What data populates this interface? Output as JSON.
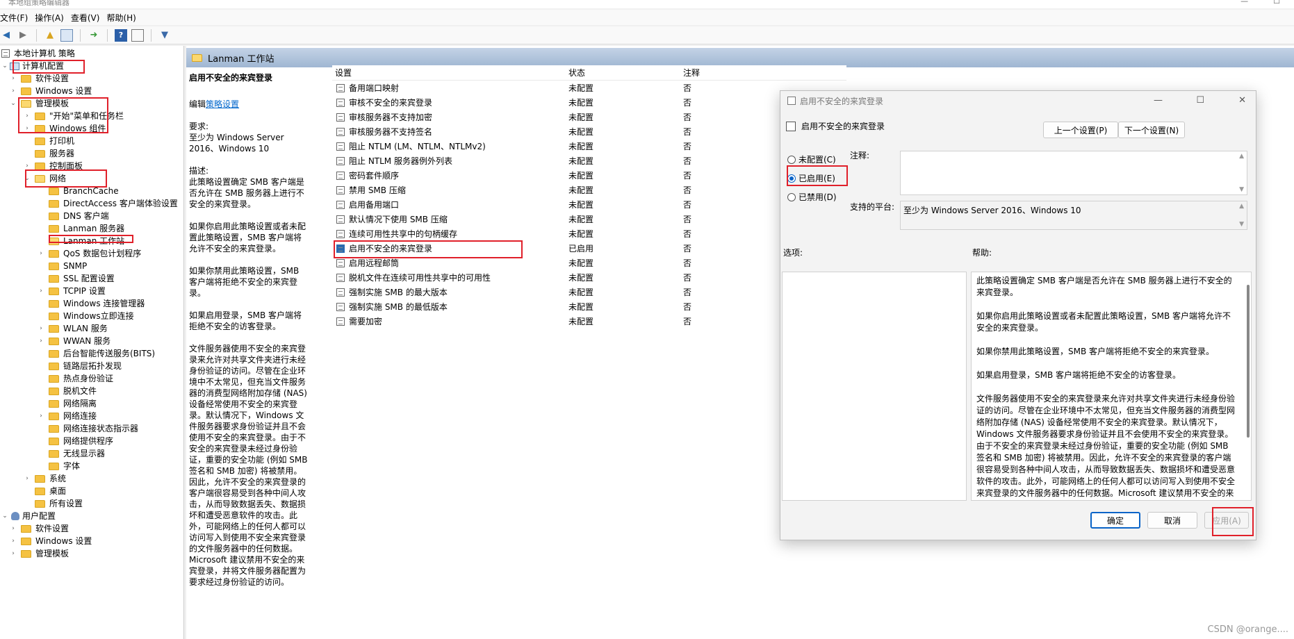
{
  "window": {
    "title": "本地组策略编辑器",
    "controls": [
      "—",
      "☐"
    ]
  },
  "menu": [
    "文件(F)",
    "操作(A)",
    "查看(V)",
    "帮助(H)"
  ],
  "toolbar_icons": [
    "back-icon",
    "forward-icon",
    "up-folder-icon",
    "show-tree-icon",
    "export-icon",
    "help-icon",
    "properties-icon",
    "filter-icon"
  ],
  "tree": {
    "root": "本地计算机 策略",
    "items": [
      {
        "label": "计算机配置"
      },
      {
        "label": "软件设置"
      },
      {
        "label": "Windows 设置"
      },
      {
        "label": "管理模板"
      },
      {
        "label": "\"开始\"菜单和任务栏"
      },
      {
        "label": "Windows 组件"
      },
      {
        "label": "打印机"
      },
      {
        "label": "服务器"
      },
      {
        "label": "控制面板"
      },
      {
        "label": "网络"
      },
      {
        "label": "BranchCache"
      },
      {
        "label": "DirectAccess 客户端体验设置"
      },
      {
        "label": "DNS 客户端"
      },
      {
        "label": "Lanman 服务器"
      },
      {
        "label": "Lanman 工作站"
      },
      {
        "label": "QoS 数据包计划程序"
      },
      {
        "label": "SNMP"
      },
      {
        "label": "SSL 配置设置"
      },
      {
        "label": "TCPIP 设置"
      },
      {
        "label": "Windows 连接管理器"
      },
      {
        "label": "Windows立即连接"
      },
      {
        "label": "WLAN 服务"
      },
      {
        "label": "WWAN 服务"
      },
      {
        "label": "后台智能传送服务(BITS)"
      },
      {
        "label": "链路层拓扑发现"
      },
      {
        "label": "热点身份验证"
      },
      {
        "label": "脱机文件"
      },
      {
        "label": "网络隔离"
      },
      {
        "label": "网络连接"
      },
      {
        "label": "网络连接状态指示器"
      },
      {
        "label": "网络提供程序"
      },
      {
        "label": "无线显示器"
      },
      {
        "label": "字体"
      },
      {
        "label": "系统"
      },
      {
        "label": "桌面"
      },
      {
        "label": "所有设置"
      },
      {
        "label": "用户配置"
      },
      {
        "label": "软件设置"
      },
      {
        "label": "Windows 设置"
      },
      {
        "label": "管理模板"
      }
    ]
  },
  "header": {
    "title": "Lanman 工作站"
  },
  "description": {
    "title": "启用不安全的来宾登录",
    "edit_prefix": "编辑",
    "edit_link": "策略设置",
    "req_label": "要求:",
    "req_text": "至少为 Windows Server 2016、Windows 10",
    "desc_label": "描述:",
    "paragraphs": [
      "此策略设置确定 SMB 客户端是否允许在 SMB 服务器上进行不安全的来宾登录。",
      "如果你启用此策略设置或者未配置此策略设置，SMB 客户端将允许不安全的来宾登录。",
      "如果你禁用此策略设置，SMB 客户端将拒绝不安全的来宾登录。",
      "如果启用登录，SMB 客户端将拒绝不安全的访客登录。",
      "文件服务器使用不安全的来宾登录来允许对共享文件夹进行未经身份验证的访问。尽管在企业环境中不太常见，但充当文件服务器的消费型网络附加存储 (NAS) 设备经常使用不安全的来宾登录。默认情况下，Windows 文件服务器要求身份验证并且不会使用不安全的来宾登录。由于不安全的来宾登录未经过身份验证，重要的安全功能 (例如 SMB 签名和 SMB 加密) 将被禁用。因此，允许不安全的来宾登录的客户端很容易受到各种中间人攻击，从而导致数据丢失、数据损坏和遭受恶意软件的攻击。此外，可能网络上的任何人都可以访问写入到使用不安全来宾登录的文件服务器中的任何数据。Microsoft 建议禁用不安全的来宾登录，并将文件服务器配置为要求经过身份验证的访问。"
    ]
  },
  "list": {
    "columns": [
      "设置",
      "状态",
      "注释"
    ],
    "rows": [
      {
        "name": "备用端口映射",
        "state": "未配置",
        "note": "否"
      },
      {
        "name": "审核不安全的来宾登录",
        "state": "未配置",
        "note": "否"
      },
      {
        "name": "审核服务器不支持加密",
        "state": "未配置",
        "note": "否"
      },
      {
        "name": "审核服务器不支持签名",
        "state": "未配置",
        "note": "否"
      },
      {
        "name": "阻止 NTLM (LM、NTLM、NTLMv2)",
        "state": "未配置",
        "note": "否"
      },
      {
        "name": "阻止 NTLM 服务器例外列表",
        "state": "未配置",
        "note": "否"
      },
      {
        "name": "密码套件顺序",
        "state": "未配置",
        "note": "否"
      },
      {
        "name": "禁用 SMB 压缩",
        "state": "未配置",
        "note": "否"
      },
      {
        "name": "启用备用端口",
        "state": "未配置",
        "note": "否"
      },
      {
        "name": "默认情况下使用 SMB 压缩",
        "state": "未配置",
        "note": "否"
      },
      {
        "name": "连续可用性共享中的句柄缓存",
        "state": "未配置",
        "note": "否"
      },
      {
        "name": "启用不安全的来宾登录",
        "state": "已启用",
        "note": "否"
      },
      {
        "name": "启用远程邮筒",
        "state": "未配置",
        "note": "否"
      },
      {
        "name": "脱机文件在连续可用性共享中的可用性",
        "state": "未配置",
        "note": "否"
      },
      {
        "name": "强制实施 SMB 的最大版本",
        "state": "未配置",
        "note": "否"
      },
      {
        "name": "强制实施 SMB 的最低版本",
        "state": "未配置",
        "note": "否"
      },
      {
        "name": "需要加密",
        "state": "未配置",
        "note": "否"
      }
    ]
  },
  "dialog": {
    "title": "启用不安全的来宾登录",
    "subtitle": "启用不安全的来宾登录",
    "prev_btn": "上一个设置(P)",
    "next_btn": "下一个设置(N)",
    "radio_not_configured": "未配置(C)",
    "radio_enabled": "已启用(E)",
    "radio_disabled": "已禁用(D)",
    "comment_label": "注释:",
    "platform_label": "支持的平台:",
    "platform_value": "至少为 Windows Server 2016、Windows 10",
    "options_label": "选项:",
    "help_label": "帮助:",
    "help_paragraphs": [
      "此策略设置确定 SMB 客户端是否允许在 SMB 服务器上进行不安全的来宾登录。",
      "如果你启用此策略设置或者未配置此策略设置，SMB 客户端将允许不安全的来宾登录。",
      "如果你禁用此策略设置，SMB 客户端将拒绝不安全的来宾登录。",
      "如果启用登录，SMB 客户端将拒绝不安全的访客登录。",
      "文件服务器使用不安全的来宾登录来允许对共享文件夹进行未经身份验证的访问。尽管在企业环境中不太常见，但充当文件服务器的消费型网络附加存储 (NAS) 设备经常使用不安全的来宾登录。默认情况下，Windows 文件服务器要求身份验证并且不会使用不安全的来宾登录。由于不安全的来宾登录未经过身份验证，重要的安全功能 (例如 SMB 签名和 SMB 加密) 将被禁用。因此，允许不安全的来宾登录的客户端很容易受到各种中间人攻击，从而导致数据丢失、数据损坏和遭受恶意软件的攻击。此外，可能网络上的任何人都可以访问写入到使用不安全来宾登录的文件服务器中的任何数据。Microsoft 建议禁用不安全的来宾登录，并将文件服务器配置为要求经过身份验证的访问。"
    ],
    "ok_btn": "确定",
    "cancel_btn": "取消",
    "apply_btn": "应用(A)"
  },
  "watermark": "CSDN @orange....",
  "colors": {
    "highlight_box": "#e0202a",
    "accent": "#0a64c8"
  }
}
